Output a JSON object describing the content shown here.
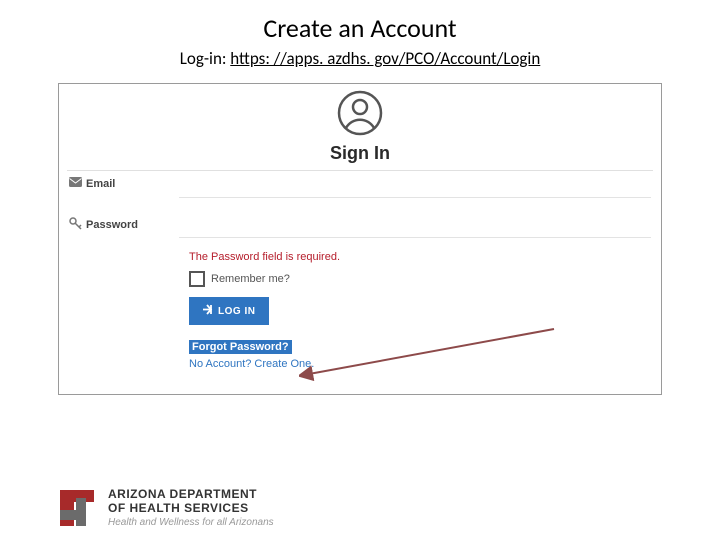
{
  "title": "Create an Account",
  "login_label": "Log-in: ",
  "login_url": "https: //apps. azdhs. gov/PCO/Account/Login",
  "form": {
    "heading": "Sign In",
    "email_label": "Email",
    "password_label": "Password",
    "error_msg": "The Password field is required.",
    "remember_label": "Remember me?",
    "login_button": "LOG IN",
    "forgot_link": "Forgot Password?",
    "create_link": "No Account? Create One."
  },
  "footer": {
    "line1": "ARIZONA DEPARTMENT",
    "line2": "OF HEALTH SERVICES",
    "tagline": "Health and Wellness for all Arizonans"
  }
}
